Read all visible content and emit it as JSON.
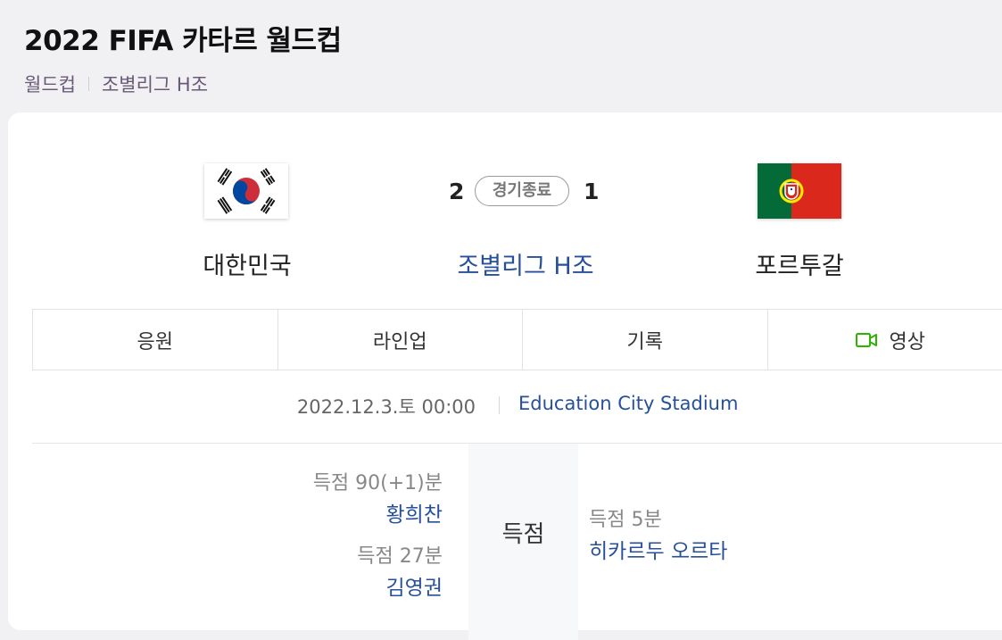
{
  "header": {
    "title": "2022 FIFA 카타르 월드컵",
    "breadcrumb": [
      "월드컵",
      "조별리그 H조"
    ]
  },
  "match": {
    "home": {
      "name": "대한민국",
      "score": "2",
      "flag": "korea-flag"
    },
    "away": {
      "name": "포르투갈",
      "score": "1",
      "flag": "portugal-flag"
    },
    "status": "경기종료",
    "group": "조별리그 H조"
  },
  "tabs": [
    {
      "label": "응원"
    },
    {
      "label": "라인업"
    },
    {
      "label": "기록"
    },
    {
      "label": "영상",
      "icon": "video-icon"
    }
  ],
  "info": {
    "datetime": "2022.12.3.토 00:00",
    "venue": "Education City Stadium"
  },
  "goals": {
    "label": "득점",
    "home": [
      {
        "type": "득점 90(+1)분",
        "player": "황희찬"
      },
      {
        "type": "득점 27분",
        "player": "김영권"
      }
    ],
    "away": [
      {
        "type": "득점 5분",
        "player": "히카르두 오르타"
      }
    ]
  },
  "colors": {
    "accent_blue": "#27509a",
    "video_green": "#2db400",
    "page_bg": "#f1f1f4"
  }
}
